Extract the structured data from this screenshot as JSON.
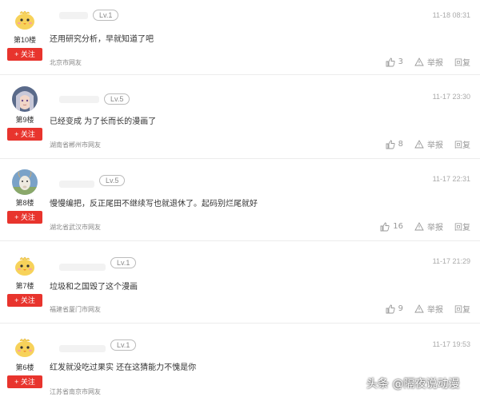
{
  "comments": [
    {
      "floor": "第10楼",
      "follow": "+ 关注",
      "level": "Lv.1",
      "time": "11-18 08:31",
      "content": "还用研究分析，早就知道了吧",
      "location": "北京市网友",
      "likes": "3",
      "report": "举报",
      "reply": "回复",
      "avatar": "yellow-chick-avatar"
    },
    {
      "floor": "第9楼",
      "follow": "+ 关注",
      "level": "Lv.5",
      "time": "11-17 23:30",
      "content": "已经变成 为了长而长的漫画了",
      "location": "湖南省郴州市网友",
      "likes": "8",
      "report": "举报",
      "reply": "回复",
      "avatar": "anime-girl-avatar"
    },
    {
      "floor": "第8楼",
      "follow": "+ 关注",
      "level": "Lv.5",
      "time": "11-17 22:31",
      "content": "慢慢编把，反正尾田不继续写也就退休了。起码别烂尾就好",
      "location": "湖北省武汉市网友",
      "likes": "16",
      "report": "举报",
      "reply": "回复",
      "avatar": "goat-avatar"
    },
    {
      "floor": "第7楼",
      "follow": "+ 关注",
      "level": "Lv.1",
      "time": "11-17 21:29",
      "content": "垃圾和之国毁了这个漫画",
      "location": "福建省厦门市网友",
      "likes": "9",
      "report": "举报",
      "reply": "回复",
      "avatar": "yellow-chick-avatar"
    },
    {
      "floor": "第6楼",
      "follow": "+ 关注",
      "level": "Lv.1",
      "time": "11-17 19:53",
      "content": "红发就没吃过果实 还在这猜能力不愧是你",
      "location": "江苏省南京市网友",
      "likes": "",
      "report": "",
      "reply": "",
      "avatar": "yellow-chick-avatar"
    }
  ],
  "watermark": "头条 @隔夜说动漫",
  "colors": {
    "follow_bg": "#e8342d",
    "divider": "#ececec"
  }
}
